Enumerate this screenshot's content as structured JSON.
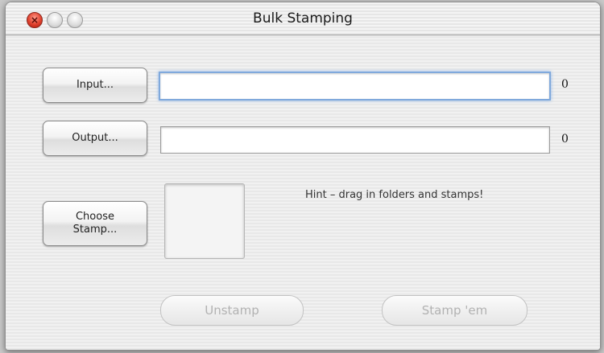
{
  "window": {
    "title": "Bulk Stamping"
  },
  "input": {
    "button_label": "Input...",
    "value": "",
    "count": "0"
  },
  "output": {
    "button_label": "Output...",
    "value": "",
    "count": "0"
  },
  "stamp": {
    "button_label": "Choose\nStamp...",
    "hint": "Hint – drag in folders and stamps!"
  },
  "actions": {
    "unstamp_label": "Unstamp",
    "stamp_label": "Stamp 'em"
  },
  "colors": {
    "focus_ring": "#80a9dc",
    "close_button": "#e0412e",
    "disabled_text": "#b2b2b2"
  }
}
